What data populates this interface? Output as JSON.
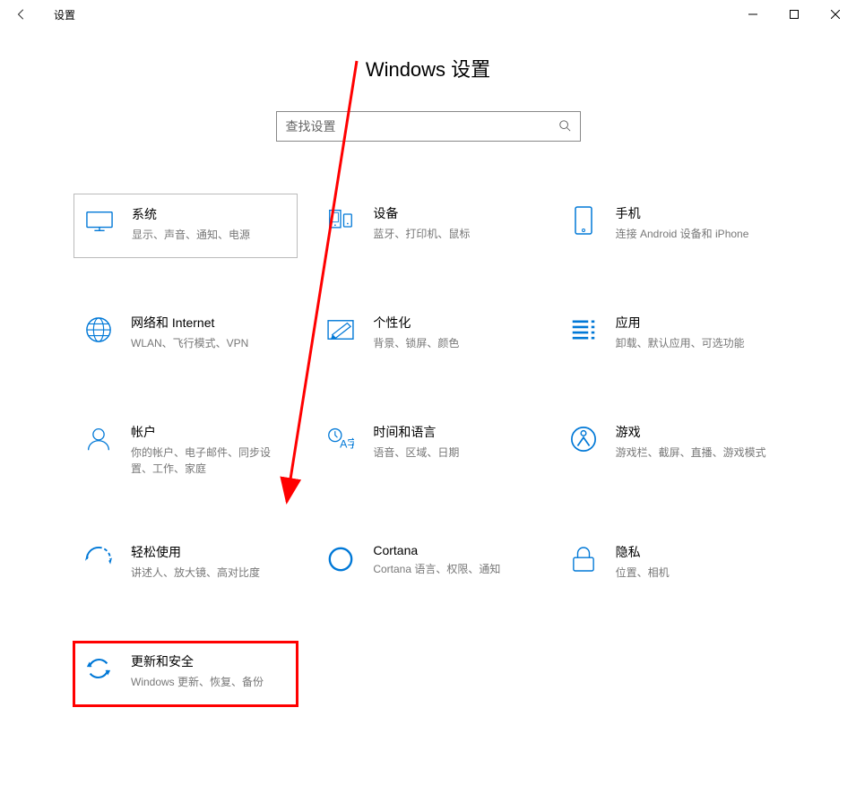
{
  "window": {
    "title": "设置"
  },
  "page": {
    "heading": "Windows 设置"
  },
  "search": {
    "placeholder": "查找设置"
  },
  "tiles": [
    {
      "id": "system",
      "title": "系统",
      "desc": "显示、声音、通知、电源",
      "selected": true,
      "highlighted": false
    },
    {
      "id": "devices",
      "title": "设备",
      "desc": "蓝牙、打印机、鼠标",
      "selected": false,
      "highlighted": false
    },
    {
      "id": "phone",
      "title": "手机",
      "desc": "连接 Android 设备和 iPhone",
      "selected": false,
      "highlighted": false
    },
    {
      "id": "network",
      "title": "网络和 Internet",
      "desc": "WLAN、飞行模式、VPN",
      "selected": false,
      "highlighted": false
    },
    {
      "id": "personalization",
      "title": "个性化",
      "desc": "背景、锁屏、颜色",
      "selected": false,
      "highlighted": false
    },
    {
      "id": "apps",
      "title": "应用",
      "desc": "卸载、默认应用、可选功能",
      "selected": false,
      "highlighted": false
    },
    {
      "id": "accounts",
      "title": "帐户",
      "desc": "你的帐户、电子邮件、同步设置、工作、家庭",
      "selected": false,
      "highlighted": false
    },
    {
      "id": "time-language",
      "title": "时间和语言",
      "desc": "语音、区域、日期",
      "selected": false,
      "highlighted": false
    },
    {
      "id": "gaming",
      "title": "游戏",
      "desc": "游戏栏、截屏、直播、游戏模式",
      "selected": false,
      "highlighted": false
    },
    {
      "id": "ease-of-access",
      "title": "轻松使用",
      "desc": "讲述人、放大镜、高对比度",
      "selected": false,
      "highlighted": false
    },
    {
      "id": "cortana",
      "title": "Cortana",
      "desc": "Cortana 语言、权限、通知",
      "selected": false,
      "highlighted": false
    },
    {
      "id": "privacy",
      "title": "隐私",
      "desc": "位置、相机",
      "selected": false,
      "highlighted": false
    },
    {
      "id": "update-security",
      "title": "更新和安全",
      "desc": "Windows 更新、恢复、备份",
      "selected": false,
      "highlighted": true
    }
  ],
  "annotation": {
    "arrow_color": "#ff0000",
    "highlight_color": "#ff0000",
    "arrow_from": "page-heading",
    "arrow_to": "tile-update-security"
  }
}
